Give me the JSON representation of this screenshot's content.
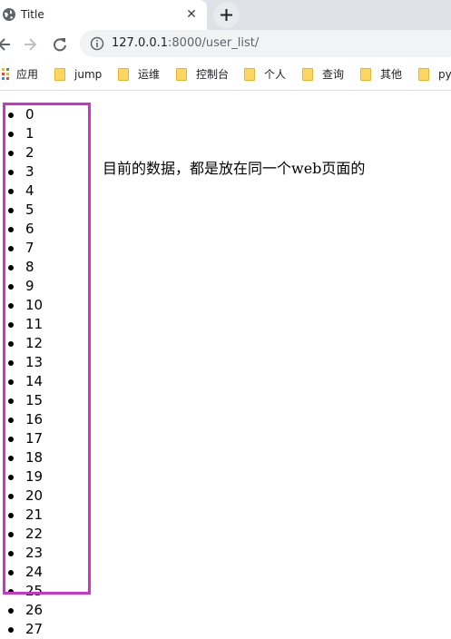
{
  "browser": {
    "tab": {
      "title": "Title",
      "favicon": "globe-icon",
      "close_icon": "close-icon"
    },
    "new_tab_icon": "plus-icon",
    "toolbar": {
      "back_icon": "arrow-left-icon",
      "forward_icon": "arrow-right-icon",
      "reload_icon": "reload-icon",
      "info_icon": "info-icon",
      "url_host": "127.0.0.1",
      "url_rest": ":8000/user_list/"
    },
    "bookmarks": [
      {
        "label": "应用",
        "icon": "apps-grid-icon"
      },
      {
        "label": "jump",
        "icon": "folder-icon"
      },
      {
        "label": "运维",
        "icon": "folder-icon"
      },
      {
        "label": "控制台",
        "icon": "folder-icon"
      },
      {
        "label": "个人",
        "icon": "folder-icon"
      },
      {
        "label": "查询",
        "icon": "folder-icon"
      },
      {
        "label": "其他",
        "icon": "folder-icon"
      },
      {
        "label": "py",
        "icon": "folder-icon"
      }
    ]
  },
  "page": {
    "items": [
      "0",
      "1",
      "2",
      "3",
      "4",
      "5",
      "6",
      "7",
      "8",
      "9",
      "10",
      "11",
      "12",
      "13",
      "14",
      "15",
      "16",
      "17",
      "18",
      "19",
      "20",
      "21",
      "22",
      "23",
      "24",
      "25",
      "26",
      "27"
    ],
    "note": "目前的数据，都是放在同一个web页面的"
  },
  "colors": {
    "highlight_border": "#cc33cc",
    "tabstrip_bg": "#dee1e6",
    "omnibox_bg": "#f1f3f4",
    "folder": "#fdd663"
  }
}
